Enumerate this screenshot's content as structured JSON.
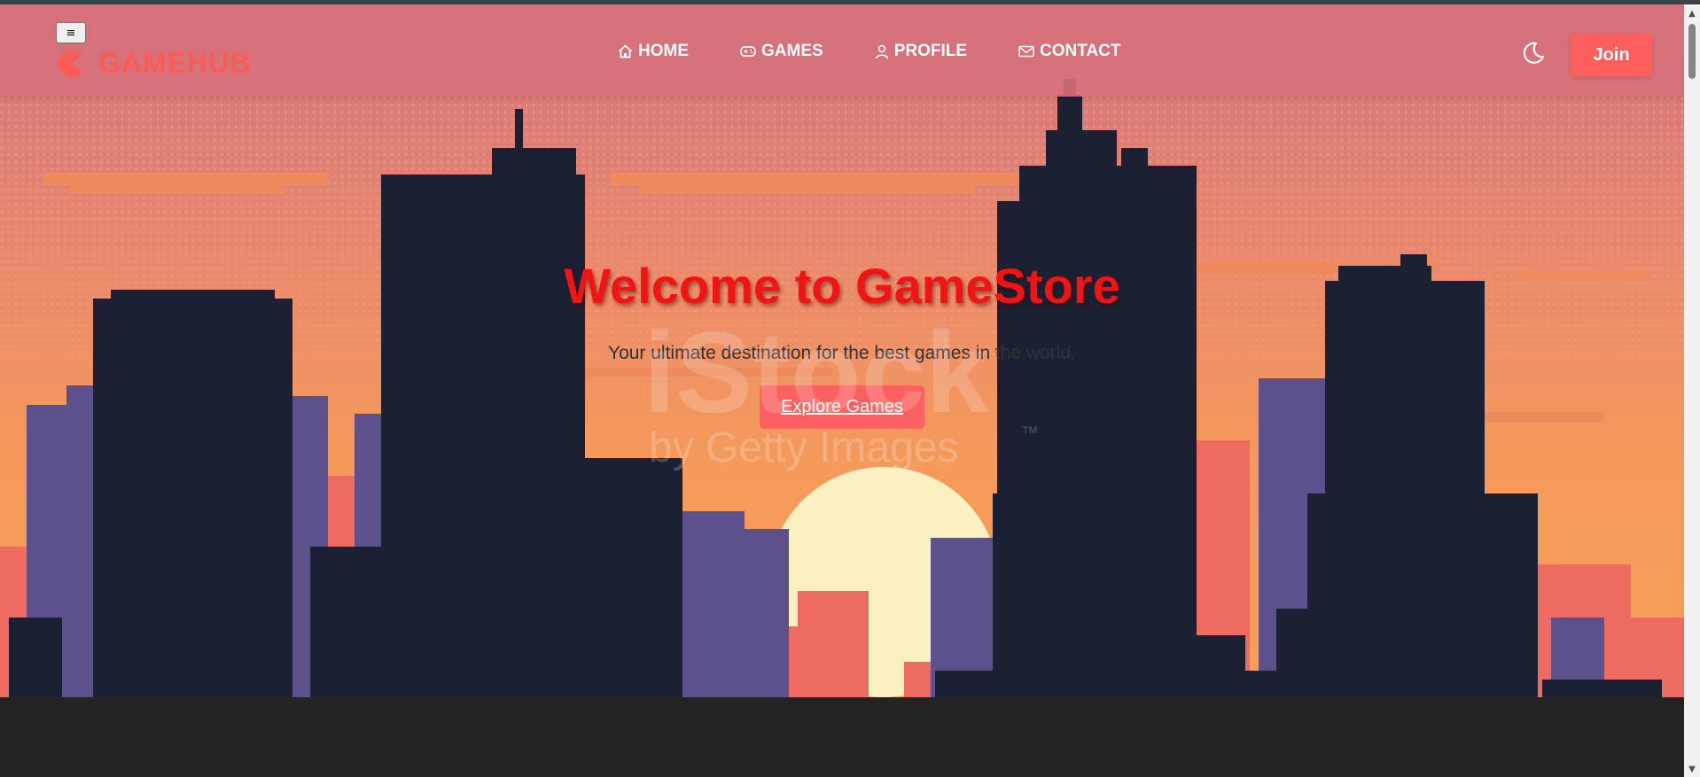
{
  "app": {
    "name": "GameStore"
  },
  "navbar": {
    "menu_toggle_glyph": "≡",
    "brand": "GAMEHUB",
    "links": [
      {
        "label": "HOME",
        "icon": "home-icon"
      },
      {
        "label": "GAMES",
        "icon": "gamepad-icon"
      },
      {
        "label": "PROFILE",
        "icon": "person-icon"
      },
      {
        "label": "CONTACT",
        "icon": "envelope-icon"
      }
    ],
    "theme_toggle_icon": "moon-icon",
    "join_label": "Join"
  },
  "hero": {
    "title": "Welcome to GameStore",
    "subtitle": "Your ultimate destination for the best games in the world.",
    "cta_label": "Explore Games",
    "watermark_line1": "iStock",
    "watermark_line2": "by Getty Images",
    "watermark_tm": "™"
  },
  "colors": {
    "accent": "#fe5e5c",
    "title_red": "#f01414",
    "navbar_pink": "#d6707a",
    "footer_dark": "#232323",
    "skyline_navy": "#1b2133",
    "building_purple": "#5c518b",
    "sun_cream": "#fbf0c2"
  }
}
